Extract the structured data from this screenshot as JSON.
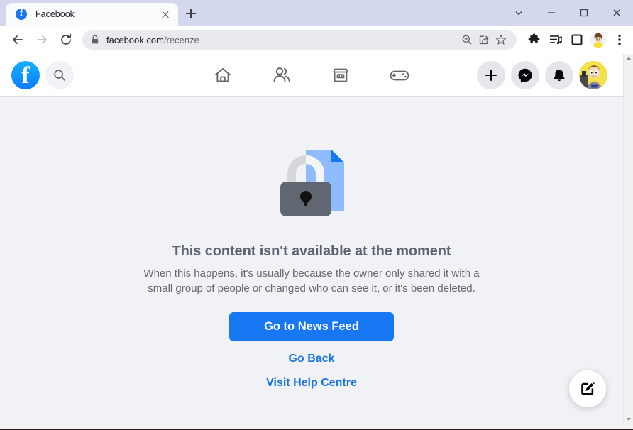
{
  "browser": {
    "tab": {
      "title": "Facebook",
      "favicon": "facebook-favicon",
      "close_icon": "close-icon"
    },
    "new_tab_label": "+",
    "window_controls": [
      {
        "name": "tab-search",
        "icon": "chevron-down-icon"
      },
      {
        "name": "minimize",
        "icon": "minimize-icon"
      },
      {
        "name": "maximize",
        "icon": "maximize-icon"
      },
      {
        "name": "close",
        "icon": "close-icon"
      }
    ],
    "nav": {
      "back": "back-arrow-icon",
      "forward": "forward-arrow-icon",
      "reload": "reload-icon"
    },
    "omnibox": {
      "lock_icon": "lock-icon",
      "url_domain": "facebook.com",
      "url_path": "/recenze",
      "url_full": "facebook.com/recenze",
      "zoom_icon": "zoom-in-icon",
      "share_icon": "share-icon",
      "bookmark_icon": "star-icon"
    },
    "toolbar_right": [
      {
        "name": "extensions",
        "icon": "puzzle-icon"
      },
      {
        "name": "media-list",
        "icon": "playlist-icon"
      },
      {
        "name": "side-panel",
        "icon": "square-icon"
      },
      {
        "name": "profile",
        "icon": "avatar-icon"
      },
      {
        "name": "chrome-menu",
        "icon": "three-dots-icon"
      }
    ]
  },
  "facebook_header": {
    "logo": "facebook-logo",
    "search_icon": "search-icon",
    "nav_items": [
      {
        "name": "home",
        "icon": "home-icon"
      },
      {
        "name": "friends",
        "icon": "people-icon"
      },
      {
        "name": "marketplace",
        "icon": "store-icon"
      },
      {
        "name": "gaming",
        "icon": "game-controller-icon"
      }
    ],
    "actions": [
      {
        "name": "create",
        "icon": "plus-icon"
      },
      {
        "name": "messenger",
        "icon": "messenger-icon"
      },
      {
        "name": "notifications",
        "icon": "bell-icon"
      }
    ],
    "account_avatar": "user-avatar"
  },
  "content": {
    "illustration": "locked-document-icon",
    "title": "This content isn't available at the moment",
    "description": "When this happens, it's usually because the owner only shared it with a small group of people or changed who can see it, or it's been deleted.",
    "primary_button": "Go to News Feed",
    "links": [
      {
        "label": "Go Back",
        "name": "go-back-link"
      },
      {
        "label": "Visit Help Centre",
        "name": "visit-help-centre-link"
      }
    ],
    "fab_icon": "compose-icon"
  },
  "colors": {
    "accent": "#1877f2",
    "link": "#1b74e4",
    "page_bg": "#f0f2f5",
    "title_text": "#5c6470",
    "body_text": "#65676b",
    "illustration_doc": "#8ebcff",
    "illustration_fold": "#1877f2",
    "illustration_lock": "#606770"
  }
}
